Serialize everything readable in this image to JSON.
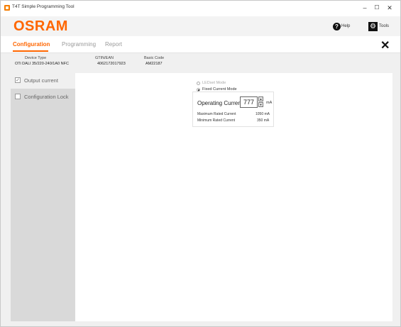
{
  "window": {
    "title": "T4T Simple Programming Tool",
    "min": "–",
    "max": "☐",
    "close": "✕"
  },
  "brand": {
    "logo": "OSRAM",
    "help_label": "Help",
    "tools_label": "Tools"
  },
  "tabs": [
    {
      "label": "Configuration",
      "active": true
    },
    {
      "label": "Programming",
      "active": false
    },
    {
      "label": "Report",
      "active": false
    }
  ],
  "close_label": "✕",
  "device": {
    "type_label": "Device Type",
    "type_value": "OTi DALI 35/220-240/1A0 NFC",
    "gtin_label": "GTIN/EAN",
    "gtin_value": "4062172017923",
    "basic_label": "Basic Code",
    "basic_value": "AM22187"
  },
  "sidebar": {
    "items": [
      {
        "label": "Output current",
        "checked": true
      },
      {
        "label": "Configuration Lock",
        "checked": false
      }
    ]
  },
  "output": {
    "mode_options": [
      {
        "label": "LEDset Mode",
        "selected": false
      },
      {
        "label": "Fixed Current Mode",
        "selected": true
      }
    ],
    "operating_label": "Operating Current",
    "operating_value": "777",
    "unit": "mA",
    "max_label": "Maximum Rated Current",
    "max_value": "1050 mA",
    "min_label": "Minimum Rated Current",
    "min_value": "350 mA"
  }
}
